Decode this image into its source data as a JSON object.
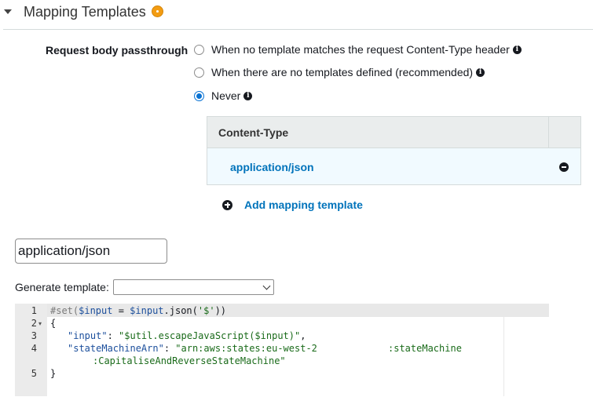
{
  "section": {
    "title": "Mapping Templates",
    "status_icon": "info-dot-icon",
    "status_color": "#f39c12"
  },
  "passthrough": {
    "label": "Request body passthrough",
    "options": [
      {
        "label": "When no template matches the request Content-Type header",
        "selected": false,
        "info": true
      },
      {
        "label": "When there are no templates defined (recommended)",
        "selected": false,
        "info": true
      },
      {
        "label": "Never",
        "selected": true,
        "info": true
      }
    ]
  },
  "content_type_table": {
    "header": "Content-Type",
    "rows": [
      "application/json"
    ]
  },
  "add_template": {
    "label": "Add mapping template"
  },
  "content_type_input": {
    "value": "application/json"
  },
  "generate_template": {
    "label": "Generate template:",
    "selected": ""
  },
  "editor": {
    "line_numbers": [
      "1",
      "2",
      "3",
      "4",
      "",
      "5"
    ],
    "lines": {
      "l1_directive": "#set(",
      "l1_var": "$input",
      "l1_eq": " = ",
      "l1_call_var": "$input",
      "l1_call": ".json(",
      "l1_arg": "'$'",
      "l1_close": "))",
      "l2": "{",
      "l3_key": "\"input\"",
      "l3_colon": ": ",
      "l3_val": "\"$util.escapeJavaScript($input)\"",
      "l3_comma": ",",
      "l4_key": "\"stateMachineArn\"",
      "l4_colon": ": ",
      "l4_val_a": "\"arn:aws:states:eu-west-2",
      "l4_val_b": ":stateMachine",
      "l4_wrap": ":CapitaliseAndReverseStateMachine\"",
      "l5": "}"
    },
    "accent_colors": {
      "active_line": "#e8e8e8",
      "gutter": "#ebebeb"
    }
  },
  "colors": {
    "link": "#0073bb",
    "radio_selected": "#0972d3",
    "table_header_bg": "#eaeded",
    "table_row_bg": "#f1faff"
  }
}
